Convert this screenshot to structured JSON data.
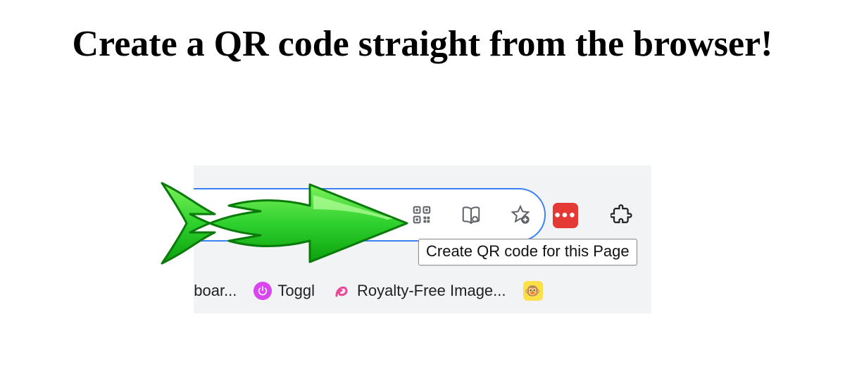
{
  "headline": "Create a QR code straight from the browser!",
  "tooltip": "Create QR code for this Page",
  "bookmarks": {
    "item0": "nboar...",
    "item1": "Toggl",
    "item2": "Royalty-Free Image..."
  },
  "icons": {
    "qr": "qr-code-icon",
    "reader": "reading-list-icon",
    "star_add": "bookmark-add-icon",
    "lastpass": "lastpass-extension-icon",
    "puzzle": "extensions-icon",
    "star_lines": "favorites-icon"
  }
}
